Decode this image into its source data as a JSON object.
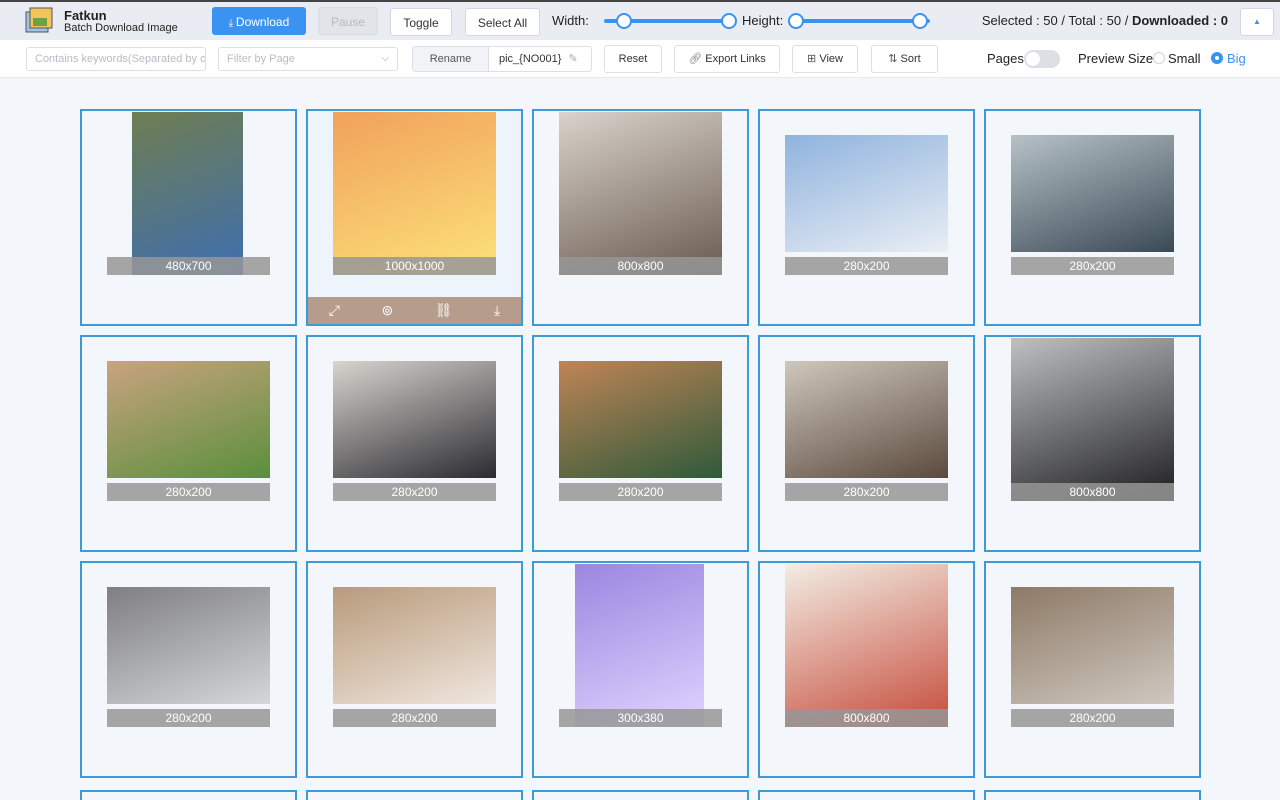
{
  "app": {
    "name": "Fatkun",
    "subtitle": "Batch Download Image"
  },
  "toolbar": {
    "download_label": "Download",
    "pause_label": "Pause",
    "toggle_label": "Toggle",
    "select_all_label": "Select All",
    "width_label": "Width:",
    "height_label": "Height:",
    "stats_prefix": "Selected : 50 / Total : 50 / ",
    "stats_downloaded": "Downloaded : 0",
    "up_icon": "▲"
  },
  "filters": {
    "keywords_placeholder": "Contains keywords(Separated by comma)",
    "page_placeholder": "Filter by Page",
    "rename_label": "Rename",
    "rename_value": "pic_{NO001}",
    "reset_label": "Reset",
    "export_label": "Export Links",
    "view_label": "View",
    "sort_label": "Sort",
    "pages_label": "Pages",
    "preview_label": "Preview Size",
    "small_label": "Small",
    "big_label": "Big"
  },
  "images": [
    {
      "size": "480x700",
      "colors": [
        "#6f7d52",
        "#3e6fb0"
      ]
    },
    {
      "size": "1000x1000",
      "colors": [
        "#f1a15b",
        "#fce27a"
      ]
    },
    {
      "size": "800x800",
      "colors": [
        "#d9d3cb",
        "#6a5a50"
      ]
    },
    {
      "size": "280x200",
      "colors": [
        "#8fb3de",
        "#e9eef4"
      ]
    },
    {
      "size": "280x200",
      "colors": [
        "#b7c2c8",
        "#3a4a55"
      ]
    },
    {
      "size": "280x200",
      "colors": [
        "#c9a37f",
        "#5a8f3c"
      ]
    },
    {
      "size": "280x200",
      "colors": [
        "#d8d4cf",
        "#2b2b30"
      ]
    },
    {
      "size": "280x200",
      "colors": [
        "#c08456",
        "#2f5a3a"
      ]
    },
    {
      "size": "280x200",
      "colors": [
        "#cfc7bd",
        "#5b4a3d"
      ]
    },
    {
      "size": "800x800",
      "colors": [
        "#bfc0c2",
        "#1d1d1f"
      ]
    },
    {
      "size": "280x200",
      "colors": [
        "#7f7f82",
        "#d5d6d8"
      ]
    },
    {
      "size": "280x200",
      "colors": [
        "#b89b7b",
        "#f0e6de"
      ]
    },
    {
      "size": "300x380",
      "colors": [
        "#9b86e0",
        "#e0d4ff"
      ]
    },
    {
      "size": "800x800",
      "colors": [
        "#f3ede4",
        "#c64c3b"
      ]
    },
    {
      "size": "280x200",
      "colors": [
        "#8e7a66",
        "#cfc8c0"
      ]
    }
  ]
}
